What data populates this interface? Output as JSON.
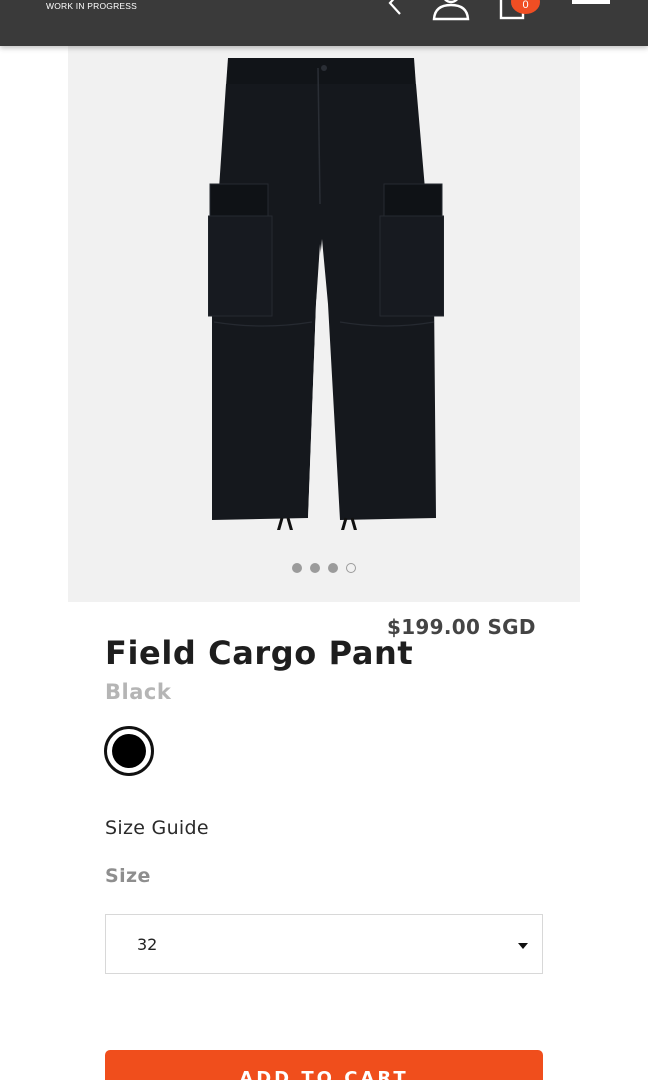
{
  "header": {
    "brand_tagline": "WORK IN PROGRESS",
    "cart_count": "0",
    "icons": [
      "back-icon",
      "account-icon",
      "cart-icon",
      "menu-icon"
    ],
    "background_color": "#3a3a3a",
    "badge_color": "#f04e23"
  },
  "gallery": {
    "image_alt": "black cargo pants",
    "slide_count": 4,
    "active_slide": 4
  },
  "product": {
    "price": "$199.00 SGD",
    "title": "Field Cargo Pant",
    "color_name": "Black",
    "swatch_color": "#000000"
  },
  "size": {
    "guide_link": "Size Guide",
    "label": "Size",
    "selected": "32"
  },
  "actions": {
    "add_to_cart": "ADD TO CART",
    "button_color": "#f04e1c"
  }
}
